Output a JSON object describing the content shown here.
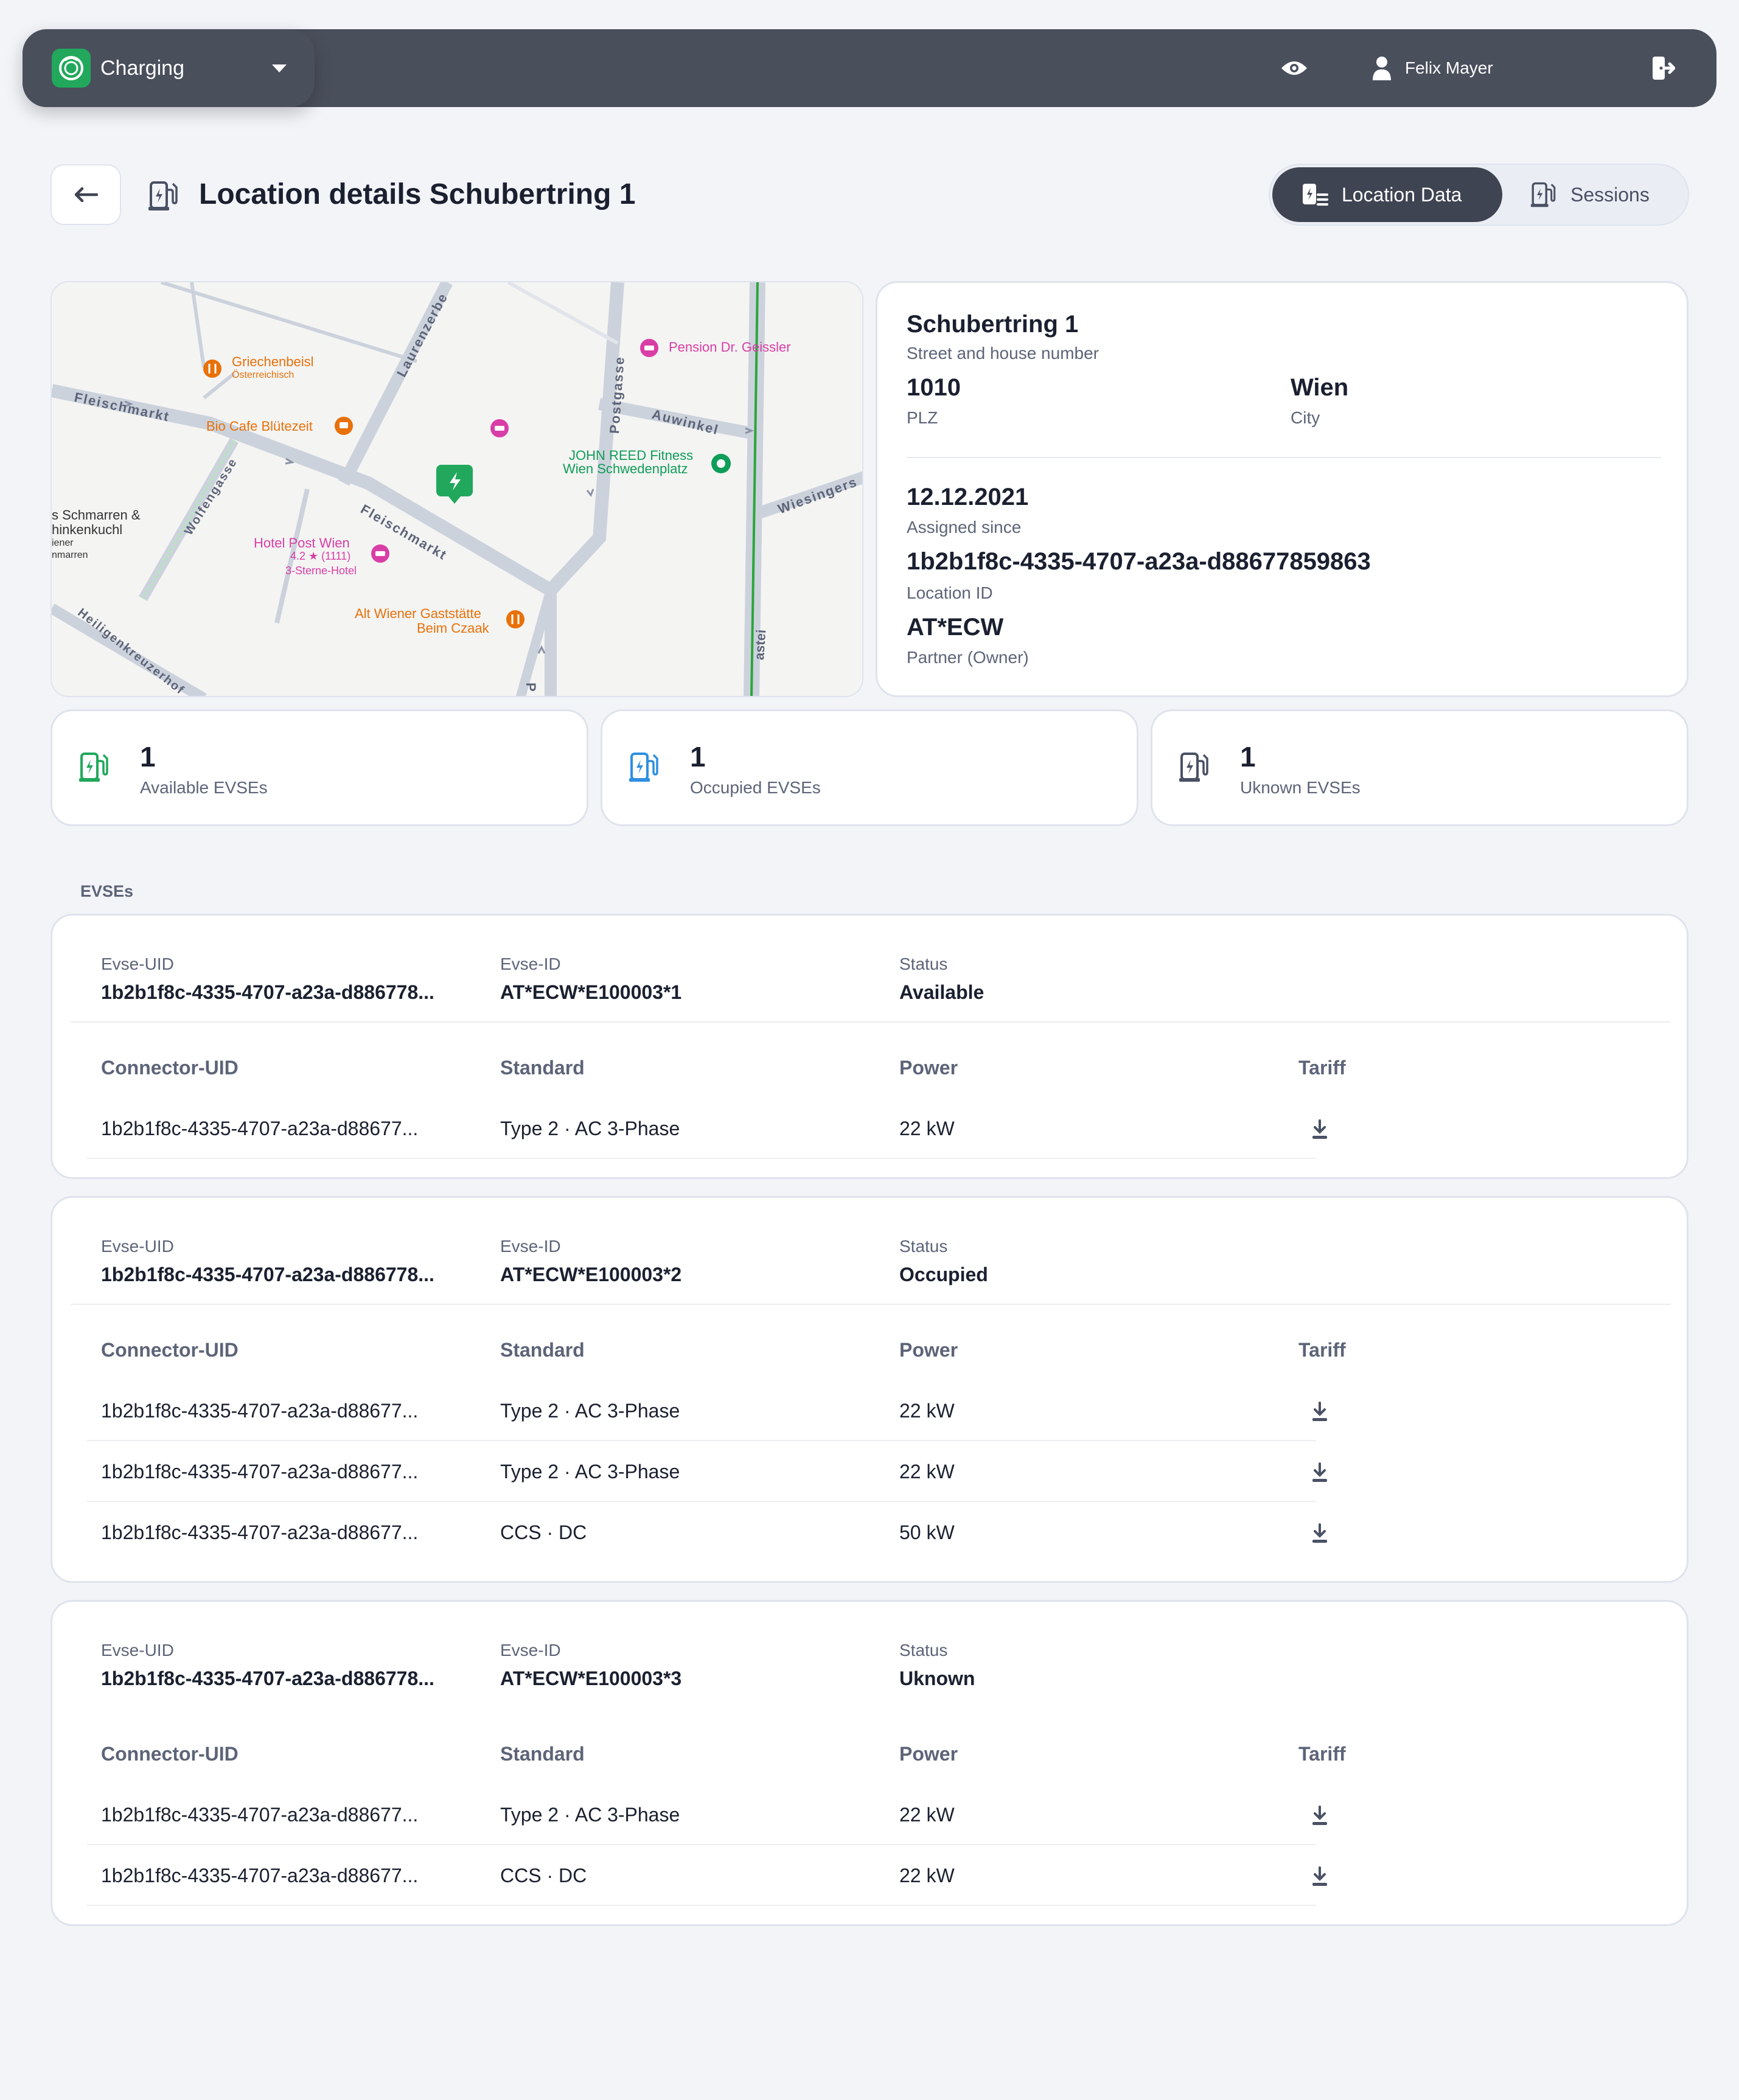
{
  "topbar": {
    "app_name": "Charging",
    "user_name": "Felix Mayer"
  },
  "header": {
    "title": "Location details Schubertring 1",
    "tabs": [
      "Location Data",
      "Sessions"
    ],
    "active_tab": "Location Data"
  },
  "map": {
    "labels": {
      "griechenbeisl": "Griechenbeisl",
      "griechenbeisl_sub": "Österreichisch",
      "pension": "Pension Dr. Geissler",
      "fleischmarkt_1": "Fleischmarkt",
      "fleischmarkt_2": "Fleischmarkt",
      "laurenzerberg": "Laurenzerbe",
      "postgasse": "Postgasse",
      "auwinkel": "Auwinkel",
      "bio_cafe": "Bio Cafe Blütezeit",
      "john_reed_1": "JOHN REED Fitness",
      "john_reed_2": "Wien Schwedenplatz",
      "wiesinger": "Wiesingers",
      "schmarren_1": "s Schmarren &",
      "schmarren_2": "hinkenkuchl",
      "schmarren_3": "iener",
      "schmarren_4": "nmarren",
      "wolfengasse": "Wolfengasse",
      "hotel_post": "Hotel Post Wien",
      "hotel_rating": "4.2 ★ (1111)",
      "hotel_class": "3-Sterne-Hotel",
      "alt_wiener_1": "Alt Wiener Gaststätte",
      "alt_wiener_2": "Beim Czaak",
      "heiligenkreuzerhof": "Heiligenkreuzerhof",
      "postgasse_bottom": "P",
      "right_street": "astei"
    }
  },
  "location": {
    "street": "Schubertring 1",
    "street_label": "Street and house number",
    "plz": "1010",
    "plz_label": "PLZ",
    "city": "Wien",
    "city_label": "City",
    "assigned_since": "12.12.2021",
    "assigned_since_label": "Assigned since",
    "location_id": "1b2b1f8c-4335-4707-a23a-d88677859863",
    "location_id_label": "Location ID",
    "partner": "AT*ECW",
    "partner_label": "Partner (Owner)"
  },
  "stats": [
    {
      "value": "1",
      "label": "Available  EVSEs",
      "color": "#21a85c"
    },
    {
      "value": "1",
      "label": "Occupied  EVSEs",
      "color": "#2f8fe0"
    },
    {
      "value": "1",
      "label": "Uknown  EVSEs",
      "color": "#4a5165"
    }
  ],
  "evses_section_label": "EVSEs",
  "evse_field_labels": {
    "uid": "Evse-UID",
    "id": "Evse-ID",
    "status": "Status"
  },
  "connector_headers": {
    "uid": "Connector-UID",
    "standard": "Standard",
    "power": "Power",
    "tariff": "Tariff"
  },
  "evses": [
    {
      "uid": "1b2b1f8c-4335-4707-a23a-d886778...",
      "id": "AT*ECW*E100003*1",
      "status": "Available",
      "connectors": [
        {
          "uid": "1b2b1f8c-4335-4707-a23a-d88677...",
          "standard": "Type 2 · AC 3-Phase",
          "power": "22 kW"
        }
      ]
    },
    {
      "uid": "1b2b1f8c-4335-4707-a23a-d886778...",
      "id": "AT*ECW*E100003*2",
      "status": "Occupied",
      "connectors": [
        {
          "uid": "1b2b1f8c-4335-4707-a23a-d88677...",
          "standard": "Type 2 · AC 3-Phase",
          "power": "22 kW"
        },
        {
          "uid": "1b2b1f8c-4335-4707-a23a-d88677...",
          "standard": "Type 2 · AC 3-Phase",
          "power": "22 kW"
        },
        {
          "uid": "1b2b1f8c-4335-4707-a23a-d88677...",
          "standard": "CCS · DC",
          "power": "50 kW"
        }
      ]
    },
    {
      "uid": "1b2b1f8c-4335-4707-a23a-d886778...",
      "id": "AT*ECW*E100003*3",
      "status": "Uknown",
      "connectors": [
        {
          "uid": "1b2b1f8c-4335-4707-a23a-d88677...",
          "standard": "Type 2 · AC 3-Phase",
          "power": "22 kW"
        },
        {
          "uid": "1b2b1f8c-4335-4707-a23a-d88677...",
          "standard": "CCS · DC",
          "power": "22 kW"
        }
      ]
    }
  ],
  "colors": {
    "accent_green": "#21a85c",
    "dark": "#3f4452",
    "poi_orange": "#e8710a",
    "poi_pink": "#d93ea6",
    "poi_teal": "#0f9d58"
  }
}
